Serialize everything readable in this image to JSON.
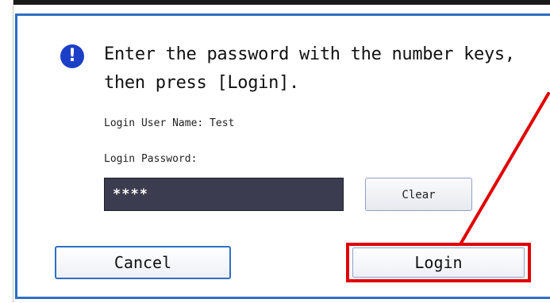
{
  "dialog": {
    "message_line1": "Enter the password with the number keys,",
    "message_line2": "then press [Login].",
    "user_name_label": "Login User Name: Test",
    "password_label": "Login Password:",
    "password_value": "****",
    "clear_label": "Clear",
    "cancel_label": "Cancel",
    "login_label": "Login",
    "info_icon_glyph": "!"
  },
  "colors": {
    "dialog_border": "#2f6fc4",
    "highlight": "#e00000",
    "info_icon": "#1c3fc8",
    "password_field": "#3c3c50"
  },
  "icons": {
    "info": "exclamation-info-icon"
  }
}
